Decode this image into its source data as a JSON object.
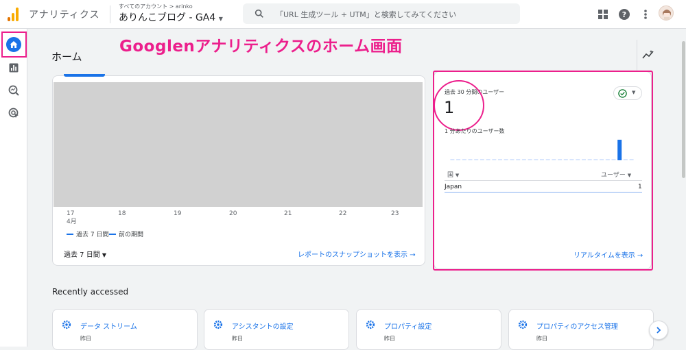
{
  "colors": {
    "accent": "#1a73e8",
    "highlight": "#ec1f8c",
    "logo_orange": "#f9ab00",
    "logo_dark": "#e37400"
  },
  "header": {
    "app_name": "アナリティクス",
    "account_line": "すべてのアカウント > arinko",
    "property_name": "ありんこブログ - GA4",
    "search_placeholder": "「URL 生成ツール + UTM」と検索してみてください",
    "icons": [
      "apps-icon",
      "help-icon",
      "more-vert-icon",
      "avatar"
    ]
  },
  "left_nav": {
    "items": [
      "home-icon",
      "reports-icon",
      "explore-icon",
      "advertising-icon"
    ]
  },
  "page": {
    "title": "ホーム",
    "annotation": "Googlenアナリティクスのホーム画面"
  },
  "overview_card": {
    "x_ticks": [
      "17",
      "18",
      "19",
      "20",
      "21",
      "22",
      "23"
    ],
    "x_month": "4月",
    "legend_current": "過去 7 日間",
    "legend_previous": "前の期間",
    "date_range": "過去 7 日間",
    "snapshot_link": "レポートのスナップショットを表示"
  },
  "realtime_card": {
    "title": "過去 30 分間のユーザー",
    "value": "1",
    "per_minute_label": "1 分あたりのユーザー数",
    "per_minute_values": [
      0,
      0,
      0,
      0,
      0,
      0,
      0,
      0,
      0,
      0,
      0,
      0,
      0,
      0,
      0,
      0,
      0,
      0,
      0,
      0,
      0,
      0,
      0,
      0,
      0,
      0,
      0,
      0,
      1,
      0,
      0
    ],
    "col_country": "国",
    "col_users": "ユーザー",
    "rows": [
      {
        "country": "Japan",
        "users": "1"
      }
    ],
    "link": "リアルタイムを表示"
  },
  "recent": {
    "title": "Recently accessed",
    "items": [
      {
        "label": "データ ストリーム",
        "sub": "昨日"
      },
      {
        "label": "アシスタントの設定",
        "sub": "昨日"
      },
      {
        "label": "プロパティ設定",
        "sub": "昨日"
      },
      {
        "label": "プロパティのアクセス管理",
        "sub": "昨日"
      }
    ]
  }
}
